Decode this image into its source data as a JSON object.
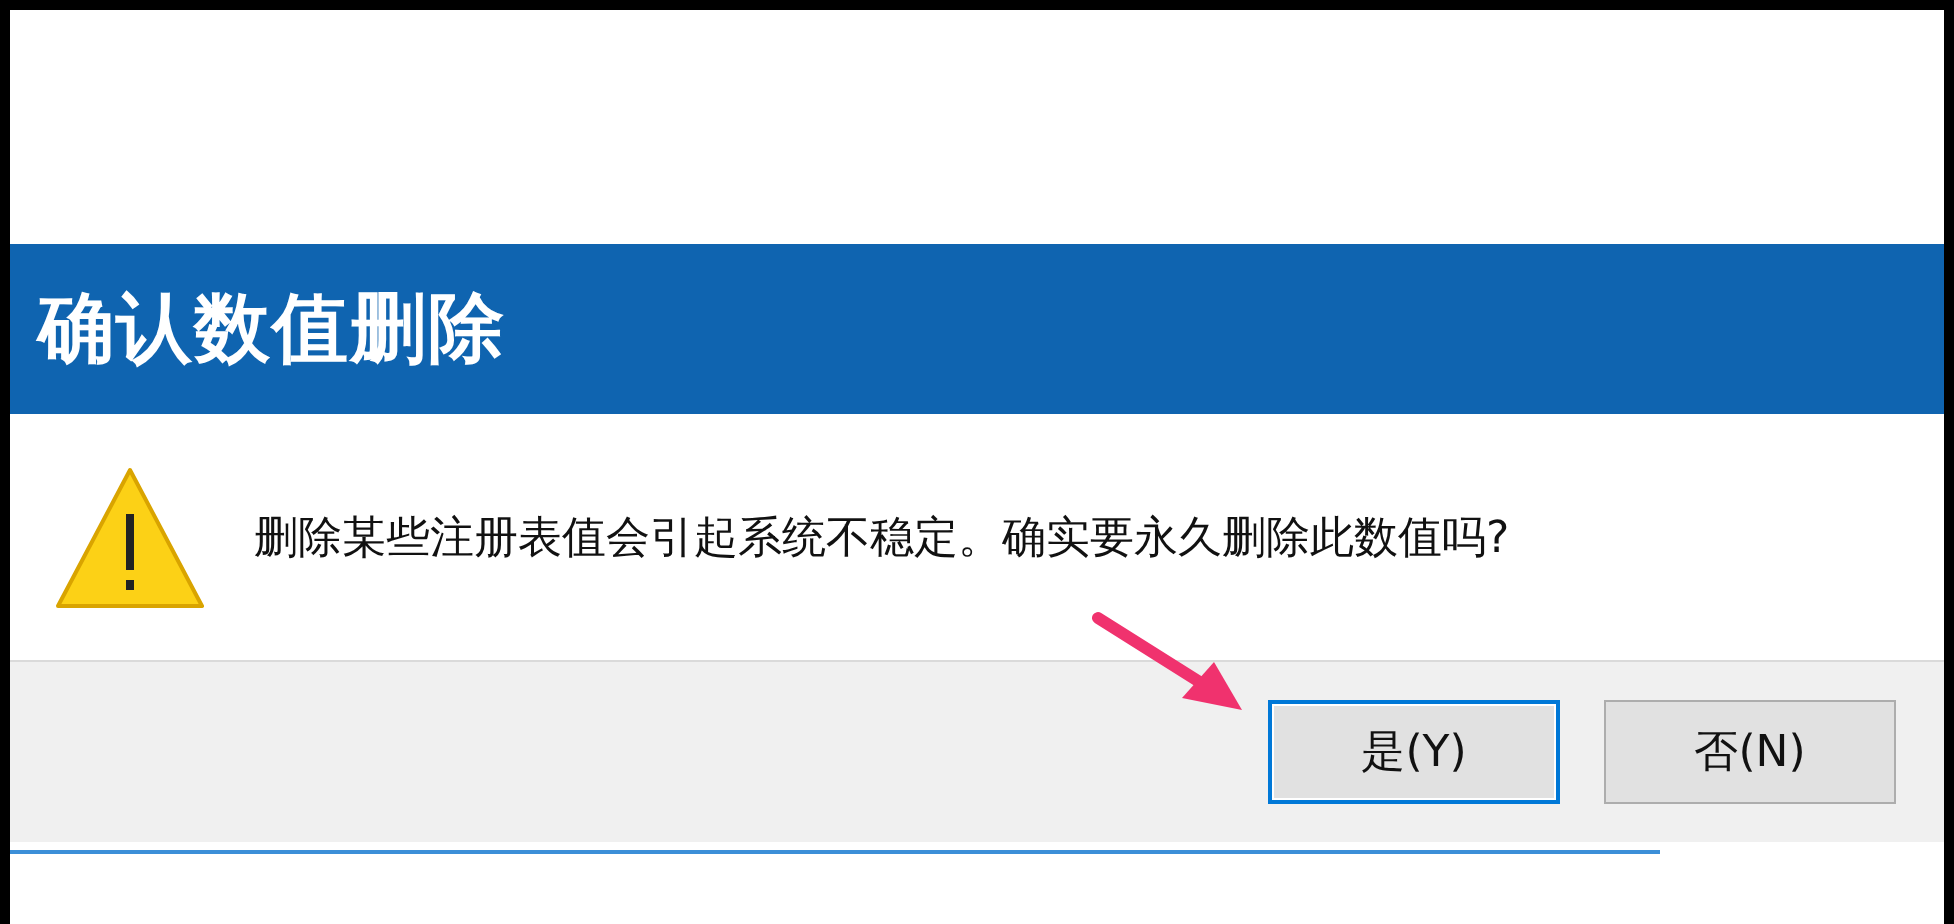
{
  "dialog": {
    "title": "确认数值删除",
    "message": "删除某些注册表值会引起系统不稳定。确实要永久删除此数值吗?",
    "kind": "warning",
    "buttons": [
      {
        "label": "是(Y)",
        "selected": true
      },
      {
        "label": "否(N)",
        "selected": false
      }
    ]
  }
}
